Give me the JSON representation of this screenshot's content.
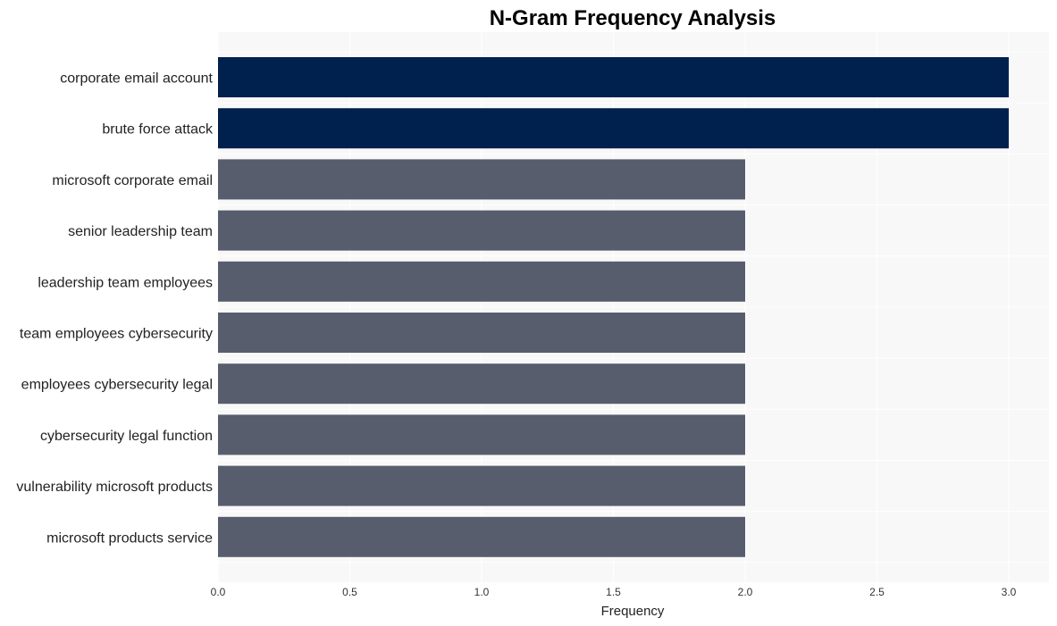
{
  "chart_data": {
    "type": "bar",
    "orientation": "horizontal",
    "title": "N-Gram Frequency Analysis",
    "xlabel": "Frequency",
    "ylabel": "",
    "xlim": [
      0,
      3.15
    ],
    "xticks": [
      0.0,
      0.5,
      1.0,
      1.5,
      2.0,
      2.5,
      3.0
    ],
    "xtick_labels": [
      "0.0",
      "0.5",
      "1.0",
      "1.5",
      "2.0",
      "2.5",
      "3.0"
    ],
    "grid": true,
    "categories": [
      "corporate email account",
      "brute force attack",
      "microsoft corporate email",
      "senior leadership team",
      "leadership team employees",
      "team employees cybersecurity",
      "employees cybersecurity legal",
      "cybersecurity legal function",
      "vulnerability microsoft products",
      "microsoft products service"
    ],
    "values": [
      3,
      3,
      2,
      2,
      2,
      2,
      2,
      2,
      2,
      2
    ],
    "colors": {
      "highlight": "#00204e",
      "default": "#575d6d",
      "plot_background": "#f8f8f8",
      "grid": "#ffffff"
    }
  }
}
